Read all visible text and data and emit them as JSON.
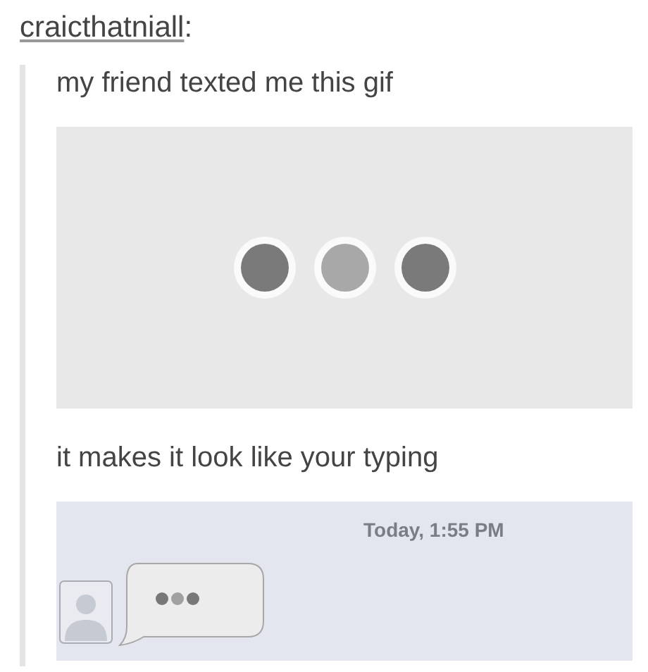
{
  "post": {
    "username": "craicthatniall",
    "username_suffix": ":",
    "blocks": [
      {
        "kind": "text",
        "text": "my friend texted me this gif"
      },
      {
        "kind": "typing-gif"
      },
      {
        "kind": "text",
        "text": "it makes it look like your typing"
      },
      {
        "kind": "chat",
        "timestamp": "Today, 1:55 PM"
      }
    ]
  }
}
